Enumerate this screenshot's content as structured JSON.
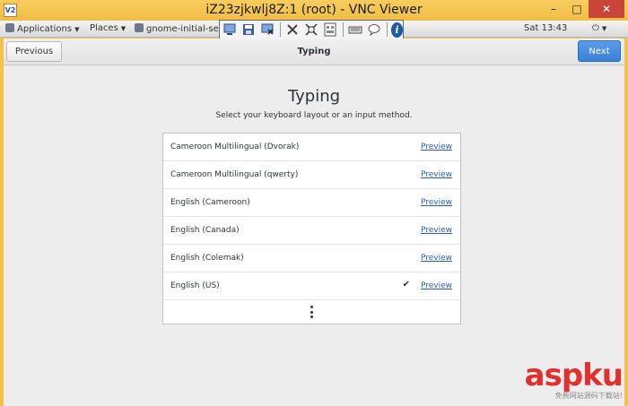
{
  "vnc_window": {
    "logo_text": "V2",
    "title": "iZ23zjkwlj8Z:1 (root) - VNC Viewer",
    "minimize": "–",
    "maximize": "□",
    "close": "✕"
  },
  "gnome_panel": {
    "applications": "Applications",
    "places": "Places",
    "task": "gnome-initial-set",
    "clock": "Sat 13:43",
    "power_icon": "⏻"
  },
  "vnc_toolbar": {
    "icons": [
      "new-connection-icon",
      "save-icon",
      "options-icon",
      "tools-icon",
      "fullscreen-icon",
      "ctrl-alt-del-icon",
      "keyboard-icon",
      "chat-icon",
      "info-icon"
    ]
  },
  "header": {
    "previous_label": "Previous",
    "title": "Typing",
    "next_label": "Next"
  },
  "main": {
    "title": "Typing",
    "subtitle": "Select your keyboard layout or an input method.",
    "preview_label": "Preview",
    "layouts": [
      {
        "name": "Cameroon Multilingual (Dvorak)",
        "selected": false
      },
      {
        "name": "Cameroon Multilingual (qwerty)",
        "selected": false
      },
      {
        "name": "English (Cameroon)",
        "selected": false
      },
      {
        "name": "English (Canada)",
        "selected": false
      },
      {
        "name": "English (Colemak)",
        "selected": false
      },
      {
        "name": "English (US)",
        "selected": true
      }
    ],
    "check_glyph": "✔"
  },
  "watermark": {
    "logo": "aspku",
    "subtitle": "免费网站源码下载站!"
  },
  "colors": {
    "accent": "#3b7fd4",
    "link": "#2a5db0",
    "vnc_frame": "#f2c24f"
  }
}
